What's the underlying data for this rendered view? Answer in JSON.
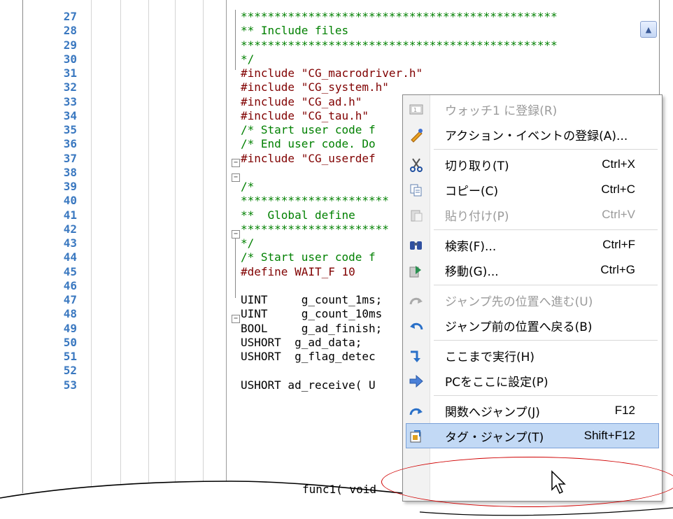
{
  "line_numbers": [
    "27",
    "28",
    "29",
    "30",
    "31",
    "32",
    "33",
    "34",
    "35",
    "36",
    "37",
    "38",
    "39",
    "40",
    "41",
    "42",
    "43",
    "44",
    "45",
    "46",
    "47",
    "48",
    "49",
    "50",
    "51",
    "52",
    "53"
  ],
  "code_lines": [
    {
      "text": "***********************************************",
      "cls": "cmt"
    },
    {
      "text": "** Include files",
      "cls": "cmt"
    },
    {
      "text": "***********************************************",
      "cls": "cmt"
    },
    {
      "text": "*/",
      "cls": "cmt"
    },
    {
      "text": "#include \"CG_macrodriver.h\"",
      "cls": "kw"
    },
    {
      "text": "#include \"CG_system.h\"",
      "cls": "kw"
    },
    {
      "text": "#include \"CG_ad.h\"",
      "cls": "kw"
    },
    {
      "text": "#include \"CG_tau.h\"",
      "cls": "kw"
    },
    {
      "text": "/* Start user code f",
      "cls": "cmt"
    },
    {
      "text": "/* End user code. Do",
      "cls": "cmt"
    },
    {
      "text": "#include \"CG_userdef",
      "cls": "kw"
    },
    {
      "text": "",
      "cls": ""
    },
    {
      "text": "/*",
      "cls": "cmt"
    },
    {
      "text": "**********************",
      "cls": "cmt"
    },
    {
      "text": "**  Global define",
      "cls": "cmt"
    },
    {
      "text": "**********************",
      "cls": "cmt"
    },
    {
      "text": "*/",
      "cls": "cmt"
    },
    {
      "text": "/* Start user code f",
      "cls": "cmt"
    },
    {
      "text": "#define WAIT_F 10",
      "cls": "kw"
    },
    {
      "text": "",
      "cls": ""
    },
    {
      "text": "UINT     g_count_1ms;",
      "cls": ""
    },
    {
      "text": "UINT     g_count_10ms",
      "cls": ""
    },
    {
      "text": "BOOL     g_ad_finish;",
      "cls": ""
    },
    {
      "text": "USHORT  g_ad_data;",
      "cls": ""
    },
    {
      "text": "USHORT  g_flag_detec",
      "cls": ""
    },
    {
      "text": "",
      "cls": ""
    },
    {
      "text": "USHORT ad_receive( U",
      "cls": ""
    }
  ],
  "partial_code": "func1( void",
  "context_menu": {
    "items": [
      {
        "icon": "watch-icon",
        "label": "ウォッチ1 に登録(R)",
        "shortcut": "",
        "disabled": true
      },
      {
        "icon": "action-event-icon",
        "label": "アクション・イベントの登録(A)...",
        "shortcut": "",
        "disabled": false
      },
      {
        "sep": true
      },
      {
        "icon": "cut-icon",
        "label": "切り取り(T)",
        "shortcut": "Ctrl+X",
        "disabled": false
      },
      {
        "icon": "copy-icon",
        "label": "コピー(C)",
        "shortcut": "Ctrl+C",
        "disabled": false
      },
      {
        "icon": "paste-icon",
        "label": "貼り付け(P)",
        "shortcut": "Ctrl+V",
        "disabled": true
      },
      {
        "sep": true
      },
      {
        "icon": "find-icon",
        "label": "検索(F)...",
        "shortcut": "Ctrl+F",
        "disabled": false
      },
      {
        "icon": "goto-icon",
        "label": "移動(G)...",
        "shortcut": "Ctrl+G",
        "disabled": false
      },
      {
        "sep": true
      },
      {
        "icon": "jump-forward-icon",
        "label": "ジャンプ先の位置へ進む(U)",
        "shortcut": "",
        "disabled": true
      },
      {
        "icon": "jump-back-icon",
        "label": "ジャンプ前の位置へ戻る(B)",
        "shortcut": "",
        "disabled": false
      },
      {
        "sep": true
      },
      {
        "icon": "run-to-here-icon",
        "label": "ここまで実行(H)",
        "shortcut": "",
        "disabled": false
      },
      {
        "icon": "set-pc-icon",
        "label": "PCをここに設定(P)",
        "shortcut": "",
        "disabled": false
      },
      {
        "sep": true
      },
      {
        "icon": "jump-function-icon",
        "label": "関数へジャンプ(J)",
        "shortcut": "F12",
        "disabled": false
      },
      {
        "icon": "tag-jump-icon",
        "label": "タグ・ジャンプ(T)",
        "shortcut": "Shift+F12",
        "disabled": false,
        "selected": true
      }
    ]
  },
  "colors": {
    "line_number": "#3a78c0",
    "comment": "#008000",
    "keyword": "#800000",
    "highlight": "#c2d9f5",
    "annotation": "#d00000"
  }
}
